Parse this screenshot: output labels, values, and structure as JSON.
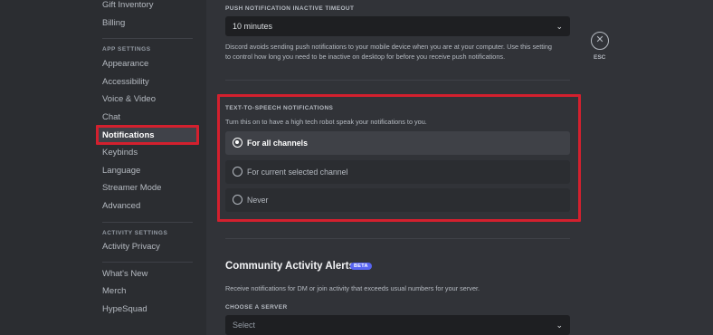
{
  "sidebar": {
    "items_top": [
      {
        "label": "Gift Inventory"
      },
      {
        "label": "Billing"
      }
    ],
    "app_settings_header": "APP SETTINGS",
    "app_items": [
      {
        "label": "Appearance"
      },
      {
        "label": "Accessibility"
      },
      {
        "label": "Voice & Video"
      },
      {
        "label": "Chat"
      },
      {
        "label": "Notifications"
      },
      {
        "label": "Keybinds"
      },
      {
        "label": "Language"
      },
      {
        "label": "Streamer Mode"
      },
      {
        "label": "Advanced"
      }
    ],
    "activity_settings_header": "ACTIVITY SETTINGS",
    "activity_items": [
      {
        "label": "Activity Privacy"
      }
    ],
    "misc_items": [
      {
        "label": "What's New"
      },
      {
        "label": "Merch"
      },
      {
        "label": "HypeSquad"
      }
    ]
  },
  "push_timeout": {
    "label": "PUSH NOTIFICATION INACTIVE TIMEOUT",
    "value": "10 minutes",
    "description_line1": "Discord avoids sending push notifications to your mobile device when you are at your computer. Use this setting",
    "description_line2": "to control how long you need to be inactive on desktop for before you receive push notifications."
  },
  "tts": {
    "label": "TEXT-TO-SPEECH NOTIFICATIONS",
    "description": "Turn this on to have a high tech robot speak your notifications to you.",
    "options": [
      {
        "label": "For all channels",
        "selected": true
      },
      {
        "label": "For current selected channel",
        "selected": false
      },
      {
        "label": "Never",
        "selected": false
      }
    ]
  },
  "community": {
    "title": "Community Activity Alerts",
    "badge": "BETA",
    "description": "Receive notifications for DM or join activity that exceeds usual numbers for your server.",
    "server_label": "CHOOSE A SERVER",
    "server_placeholder": "Select"
  },
  "esc": {
    "icon": "close-icon",
    "label": "ESC"
  },
  "colors": {
    "highlight": "#d3202e",
    "accent": "#5865f2"
  }
}
